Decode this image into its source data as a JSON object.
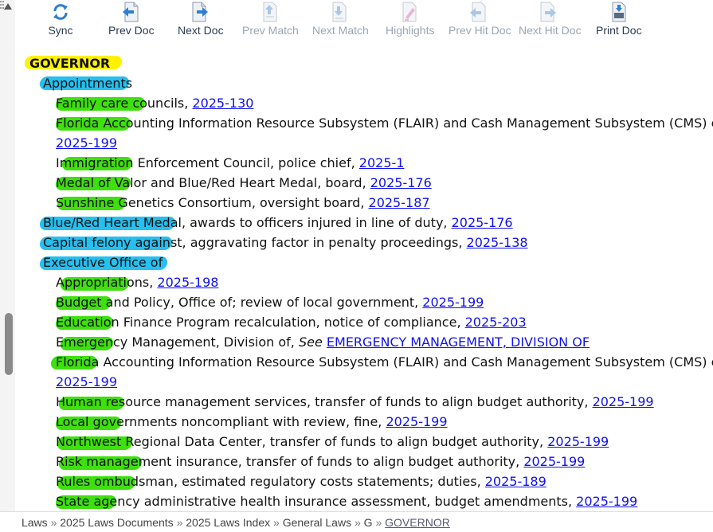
{
  "toolbar": {
    "buttons": [
      {
        "label": "Sync",
        "enabled": true,
        "icon": "sync-icon"
      },
      {
        "label": "Prev Doc",
        "enabled": true,
        "icon": "prev-doc-icon"
      },
      {
        "label": "Next Doc",
        "enabled": true,
        "icon": "next-doc-icon"
      },
      {
        "label": "Prev Match",
        "enabled": false,
        "icon": "prev-match-icon"
      },
      {
        "label": "Next Match",
        "enabled": false,
        "icon": "next-match-icon"
      },
      {
        "label": "Highlights",
        "enabled": false,
        "icon": "highlighter-icon"
      },
      {
        "label": "Prev Hit Doc",
        "enabled": false,
        "icon": "prev-hit-doc-icon"
      },
      {
        "label": "Next Hit Doc",
        "enabled": false,
        "icon": "next-hit-doc-icon"
      },
      {
        "label": "Print Doc",
        "enabled": true,
        "icon": "printer-icon"
      }
    ]
  },
  "index": {
    "heading": "GOVERNOR",
    "entries": [
      {
        "text": "Appointments",
        "link": ""
      },
      {
        "text": "Family care councils, ",
        "link": "2025-130"
      },
      {
        "text": "Florida Accounting Information Resource Subsystem (FLAIR) and Cash Management Subsystem (CMS) componen",
        "link": ""
      },
      {
        "text": "",
        "link": "2025-199"
      },
      {
        "text": "Immigration Enforcement Council, police chief, ",
        "link": "2025-1"
      },
      {
        "text": "Medal of Valor and Blue/Red Heart Medal, board, ",
        "link": "2025-176"
      },
      {
        "text": "Sunshine Genetics Consortium, oversight board, ",
        "link": "2025-187"
      },
      {
        "text": "Blue/Red Heart Medal, awards to officers injured in line of duty, ",
        "link": "2025-176"
      },
      {
        "text": "Capital felony against, aggravating factor in penalty proceedings, ",
        "link": "2025-138"
      },
      {
        "text": "Executive Office of",
        "link": ""
      },
      {
        "text": "Appropriations, ",
        "link": "2025-198"
      },
      {
        "text": "Budget and Policy, Office of; review of local government, ",
        "link": "2025-199"
      },
      {
        "text": "Education Finance Program recalculation, notice of compliance, ",
        "link": "2025-203"
      },
      {
        "text": "Emergency Management, Division of, ",
        "see": "See",
        "link": "EMERGENCY MANAGEMENT, DIVISION OF"
      },
      {
        "text": "Florida Accounting Information Resource Subsystem (FLAIR) and Cash Management Subsystem (CMS) componen",
        "link": ""
      },
      {
        "text": "",
        "link": "2025-199"
      },
      {
        "text": "Human resource management services, transfer of funds to align budget authority, ",
        "link": "2025-199"
      },
      {
        "text": "Local governments noncompliant with review, fine, ",
        "link": "2025-199"
      },
      {
        "text": "Northwest Regional Data Center, transfer of funds to align budget authority, ",
        "link": "2025-199"
      },
      {
        "text": "Risk management insurance, transfer of funds to align budget authority, ",
        "link": "2025-199"
      },
      {
        "text": "Rules ombudsman, estimated regulatory costs statements; duties, ",
        "link": "2025-189"
      },
      {
        "text": "State agency administrative health insurance assessment, budget amendments, ",
        "link": "2025-199"
      }
    ]
  },
  "breadcrumb": {
    "items": [
      "Laws",
      "2025 Laws Documents",
      "2025 Laws Index",
      "General Laws",
      "G"
    ],
    "current": "GOVERNOR",
    "separator": "»"
  },
  "colors": {
    "highlight_yellow": "#fff200",
    "highlight_blue": "#25bff0",
    "highlight_green": "#3ee00e",
    "link": "#1010ee"
  }
}
